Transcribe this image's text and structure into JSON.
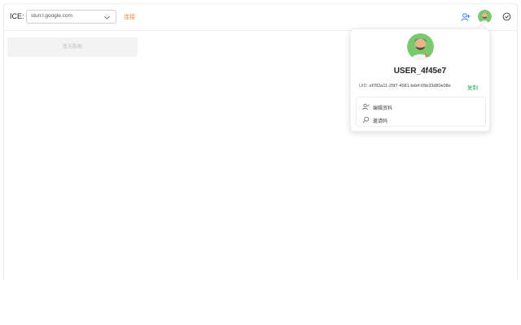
{
  "topbar": {
    "ice_label": "ICE:",
    "ice_value": "stun:l.google.com",
    "connect_label": "连接"
  },
  "main": {
    "empty_button_label": "暂无数据"
  },
  "profile": {
    "username": "USER_4f45e7",
    "uid_label": "UID:",
    "uid_value": "ef782a11-25f7-4581-bdef-65b33d80e08e",
    "copy_label": "复制",
    "menu": [
      {
        "label": "编辑资料",
        "icon": "edit-user-icon"
      },
      {
        "label": "邀请码",
        "icon": "search-icon"
      }
    ]
  },
  "colors": {
    "accent_orange": "#ff8a3d",
    "accent_green": "#27ae60",
    "accent_blue": "#3b82f6"
  }
}
